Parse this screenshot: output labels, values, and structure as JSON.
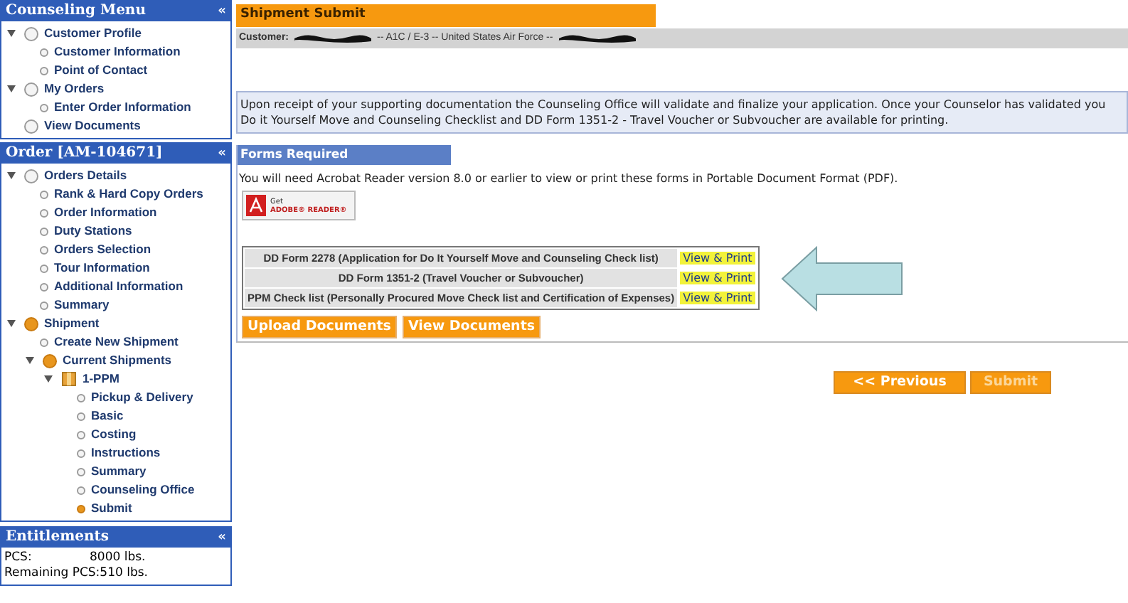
{
  "sidebar": {
    "counseling_menu": {
      "title": "Counseling Menu",
      "collapse": "«",
      "items": [
        {
          "label": "Customer Profile",
          "kind": "group",
          "active": false,
          "expanded": true,
          "children": [
            {
              "label": "Customer Information",
              "kind": "leaf",
              "active": false
            },
            {
              "label": "Point of Contact",
              "kind": "leaf",
              "active": false
            }
          ]
        },
        {
          "label": "My Orders",
          "kind": "group",
          "active": false,
          "expanded": true,
          "children": [
            {
              "label": "Enter Order Information",
              "kind": "leaf",
              "active": false
            }
          ]
        },
        {
          "label": "View Documents",
          "kind": "group",
          "active": false
        }
      ]
    },
    "order_menu": {
      "title": "Order [AM-104671]",
      "collapse": "«",
      "items": [
        {
          "label": "Orders Details",
          "kind": "group",
          "active": false,
          "expanded": true,
          "children": [
            {
              "label": "Rank & Hard Copy Orders",
              "kind": "leaf",
              "active": false
            },
            {
              "label": "Order Information",
              "kind": "leaf",
              "active": false
            },
            {
              "label": "Duty Stations",
              "kind": "leaf",
              "active": false
            },
            {
              "label": "Orders Selection",
              "kind": "leaf",
              "active": false
            },
            {
              "label": "Tour Information",
              "kind": "leaf",
              "active": false
            },
            {
              "label": "Additional Information",
              "kind": "leaf",
              "active": false
            },
            {
              "label": "Summary",
              "kind": "leaf",
              "active": false
            }
          ]
        },
        {
          "label": "Shipment",
          "kind": "group",
          "active": true,
          "expanded": true,
          "children": [
            {
              "label": "Create New Shipment",
              "kind": "leaf",
              "active": false
            },
            {
              "label": "Current Shipments",
              "kind": "group",
              "active": true,
              "expanded": true,
              "children": [
                {
                  "label": "1-PPM",
                  "kind": "package",
                  "active": true,
                  "expanded": true,
                  "children": [
                    {
                      "label": "Pickup & Delivery",
                      "kind": "leaf",
                      "active": false
                    },
                    {
                      "label": "Basic",
                      "kind": "leaf",
                      "active": false
                    },
                    {
                      "label": "Costing",
                      "kind": "leaf",
                      "active": false
                    },
                    {
                      "label": "Instructions",
                      "kind": "leaf",
                      "active": false
                    },
                    {
                      "label": "Summary",
                      "kind": "leaf",
                      "active": false
                    },
                    {
                      "label": "Counseling Office",
                      "kind": "leaf",
                      "active": false
                    },
                    {
                      "label": "Submit",
                      "kind": "leaf",
                      "active": true
                    }
                  ]
                }
              ]
            }
          ]
        }
      ]
    },
    "entitlements": {
      "title": "Entitlements",
      "collapse": "«",
      "rows": [
        {
          "label": "PCS:",
          "value": "8000 lbs."
        },
        {
          "label": "Remaining PCS:",
          "value": "510 lbs."
        }
      ]
    }
  },
  "page": {
    "title": "Shipment Submit",
    "customer": {
      "label": "Customer:",
      "parts": [
        "-- A1C / E-3 -- United States Air Force --"
      ]
    },
    "notice": [
      "Upon receipt of your supporting documentation the Counseling Office will validate and finalize your application. Once your Counselor has validated you",
      "Do it Yourself Move and Counseling Checklist and DD Form 1351-2 - Travel Voucher or Subvoucher are available for printing."
    ],
    "forms": {
      "title": "Forms Required",
      "note": "You will need Acrobat Reader version 8.0 or earlier to view or print these forms in Portable Document Format (PDF).",
      "adobe": {
        "get": "Get",
        "name": "ADOBE® READER®"
      },
      "rows": [
        {
          "name": "DD Form 2278 (Application for Do It Yourself Move and Counseling Check list)",
          "link": "View & Print"
        },
        {
          "name": "DD Form 1351-2 (Travel Voucher or Subvoucher)",
          "link": "View & Print"
        },
        {
          "name": "PPM Check list (Personally Procured Move Check list and Certification of Expenses)",
          "link": "View & Print"
        }
      ],
      "buttons": [
        "Upload Documents",
        "View Documents"
      ]
    },
    "nav": [
      {
        "label": "<< Previous",
        "disabled": false
      },
      {
        "label": "Submit",
        "disabled": true
      }
    ]
  }
}
